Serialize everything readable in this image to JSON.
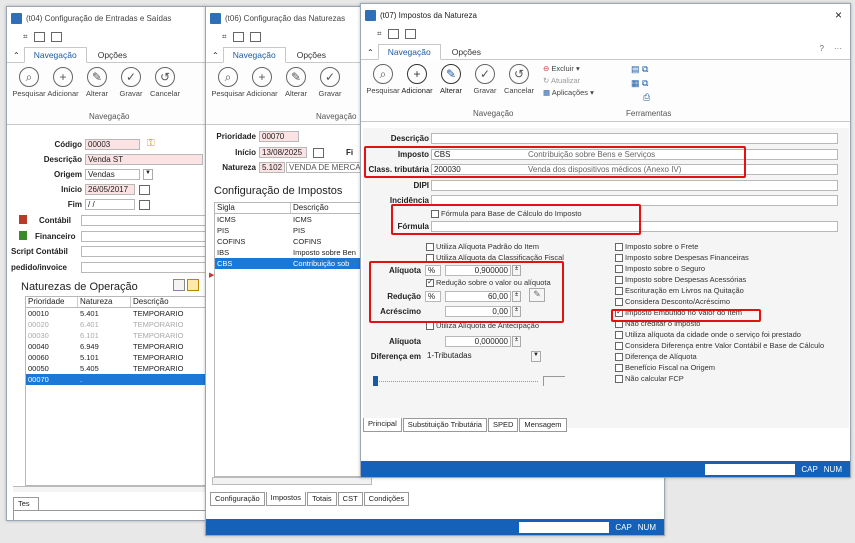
{
  "win1": {
    "title": "(t04) Configuração de Entradas e Saídas",
    "tabs": [
      "Navegação",
      "Opções"
    ],
    "buttons": [
      "Pesquisar",
      "Adicionar",
      "Alterar",
      "Gravar",
      "Cancelar"
    ],
    "group_label": "Navegação",
    "fields": {
      "codigo_label": "Código",
      "codigo_value": "00003",
      "descricao_label": "Descrição",
      "descricao_value": "Venda ST",
      "origem_label": "Origem",
      "origem_value": "Vendas",
      "inicio_label": "Início",
      "inicio_value": "26/05/2017",
      "fim_label": "Fim",
      "fim_value": "/ /",
      "contabil_label": "Contábil",
      "financeiro_label": "Financeiro",
      "script_label": "Script Contábil",
      "pedido_label": "pedido/invoice"
    },
    "section_title": "Naturezas de Operação",
    "grid_headers": [
      "Prioridade",
      "Natureza",
      "Descrição"
    ],
    "grid_rows": [
      {
        "p": "00010",
        "n": "5.401",
        "d": "TEMPORARIO",
        "dim": false
      },
      {
        "p": "00020",
        "n": "6.401",
        "d": "TEMPORARIO",
        "dim": true
      },
      {
        "p": "00030",
        "n": "6.101",
        "d": "TEMPORARIO",
        "dim": true
      },
      {
        "p": "00040",
        "n": "6.949",
        "d": "TEMPORARIO",
        "dim": false
      },
      {
        "p": "00060",
        "n": "5.101",
        "d": "TEMPORARIO",
        "dim": false
      },
      {
        "p": "00050",
        "n": "5.405",
        "d": "TEMPORARIO",
        "dim": false
      },
      {
        "p": "00070",
        "n": ".",
        "d": "",
        "dim": false,
        "sel": true
      }
    ],
    "bottom_tab": "Tes"
  },
  "win2": {
    "title": "(t06) Configuração das Naturezas",
    "tabs": [
      "Navegação",
      "Opções"
    ],
    "buttons": [
      "Pesquisar",
      "Adicionar",
      "Alterar",
      "Gravar"
    ],
    "group_label": "Navegação",
    "prioridade_label": "Prioridade",
    "prioridade_value": "00070",
    "inicio_label": "Início",
    "inicio_value": "13/08/2025",
    "fim_label_partial": "Fi",
    "natureza_label": "Natureza",
    "natureza_code": "5.102",
    "natureza_desc": "VENDA DE MERCADO",
    "section_title": "Configuração de Impostos",
    "grid_headers": [
      "Sigla",
      "Descrição"
    ],
    "grid_rows": [
      {
        "s": "ICMS",
        "d": "ICMS"
      },
      {
        "s": "PIS",
        "d": "PIS"
      },
      {
        "s": "COFINS",
        "d": "COFINS"
      },
      {
        "s": "IBS",
        "d": "Imposto sobre Ben"
      },
      {
        "s": "CBS",
        "d": "Contribuição sob",
        "sel": true
      }
    ],
    "bottom_tabs": [
      "Configuração",
      "Impostos",
      "Totais",
      "CST",
      "Condições"
    ],
    "status": [
      "CAP",
      "NUM"
    ]
  },
  "win3": {
    "title": "(t07) Impostos da Natureza",
    "tabs": [
      "Navegação",
      "Opções"
    ],
    "buttons": [
      "Pesquisar",
      "Adicionar",
      "Alterar",
      "Gravar",
      "Cancelar"
    ],
    "side_buttons": [
      "Excluir",
      "Atualizar",
      "Aplicações"
    ],
    "group_labels": [
      "Navegação",
      "Ferramentas"
    ],
    "descricao_label": "Descrição",
    "imposto_label": "Imposto",
    "imposto_code": "CBS",
    "imposto_desc": "Contribuição sobre Bens e Serviços",
    "class_label": "Class. tributária",
    "class_code": "200030",
    "class_desc": "Venda dos dispositivos médicos  (Anexo IV)",
    "dipi_label": "DIPI",
    "incidencia_label": "Incidência",
    "formula_check": "Fórmula para Base de Cálculo do Imposto",
    "formula_label": "Fórmula",
    "left_checks": [
      "Utiliza Alíquota Padrão do Item",
      "Utiliza Alíquota da Classificação Fiscal"
    ],
    "aliquota_label": "Alíquota",
    "aliquota_unit": "%",
    "aliquota_value": "0,900000",
    "reducao_check": "Redução sobre o valor ou alíquota",
    "reducao_label": "Redução",
    "reducao_unit": "%",
    "reducao_value": "60,00",
    "acrescimo_label": "Acréscimo",
    "acrescimo_value": "0,00",
    "antecipacao_check": "Utiliza Alíquota de Antecipação",
    "aliquota2_label": "Alíquota",
    "aliquota2_value": "0,000000",
    "diferenca_label": "Diferença em",
    "diferenca_value": "1-Tributadas",
    "right_checks": [
      {
        "t": "Imposto sobre o Frete",
        "on": false
      },
      {
        "t": "Imposto sobre Despesas Financeiras",
        "on": false
      },
      {
        "t": "Imposto sobre o Seguro",
        "on": false
      },
      {
        "t": "Imposto sobre Despesas Acessórias",
        "on": false
      },
      {
        "t": "Escrituração em Livros na Quitação",
        "on": false
      },
      {
        "t": "Considera Desconto/Acréscimo",
        "on": false
      },
      {
        "t": "Imposto Embutido no Valor do Item",
        "on": true
      },
      {
        "t": "Não creditar o imposto",
        "on": false
      },
      {
        "t": "Utiliza alíquota da cidade onde o serviço foi prestado",
        "on": false
      },
      {
        "t": "Considera Diferença entre Valor Contábil e Base de Cálculo",
        "on": false
      },
      {
        "t": "Diferença de Alíquota",
        "on": false
      },
      {
        "t": "Benefício Fiscal na Origem",
        "on": false
      },
      {
        "t": "Não calcular FCP",
        "on": false
      }
    ],
    "bottom_tabs": [
      "Principal",
      "Substituição Tributária",
      "SPED",
      "Mensagem"
    ],
    "status": [
      "CAP",
      "NUM"
    ],
    "close": "×",
    "help": "?",
    "more": "···"
  },
  "colors": {
    "accent": "#1560b8",
    "highlight": "#e21212",
    "selection": "#1b78d6",
    "required_bg": "#fbe3e3"
  }
}
